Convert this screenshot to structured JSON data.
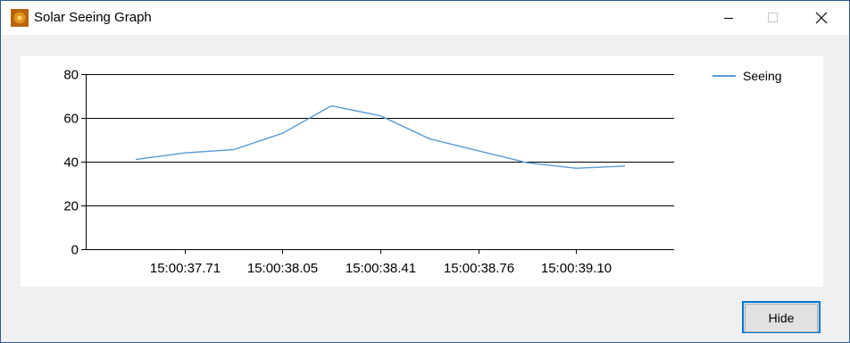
{
  "window": {
    "title": "Solar Seeing Graph",
    "icon": "sun-icon"
  },
  "controls": {
    "minimize_icon": "minimize-icon",
    "maximize_icon": "maximize-icon",
    "close_icon": "close-icon"
  },
  "legend": {
    "label": "Seeing",
    "placement": "top-right"
  },
  "buttons": {
    "hide_label": "Hide"
  },
  "chart_data": {
    "type": "line",
    "title": "",
    "xlabel": "",
    "ylabel": "",
    "ylim": [
      0,
      80
    ],
    "yticks": [
      0,
      20,
      40,
      60,
      80
    ],
    "xticks": [
      "15:00:37.71",
      "15:00:38.05",
      "15:00:38.41",
      "15:00:38.76",
      "15:00:39.10"
    ],
    "grid": "horizontal",
    "colors": {
      "series": "#5b9bd5",
      "grid": "#000000"
    },
    "series": [
      {
        "name": "Seeing",
        "values": [
          41,
          44,
          45.5,
          53,
          65.5,
          61,
          50.5,
          45,
          39.5,
          37,
          38
        ]
      }
    ]
  }
}
